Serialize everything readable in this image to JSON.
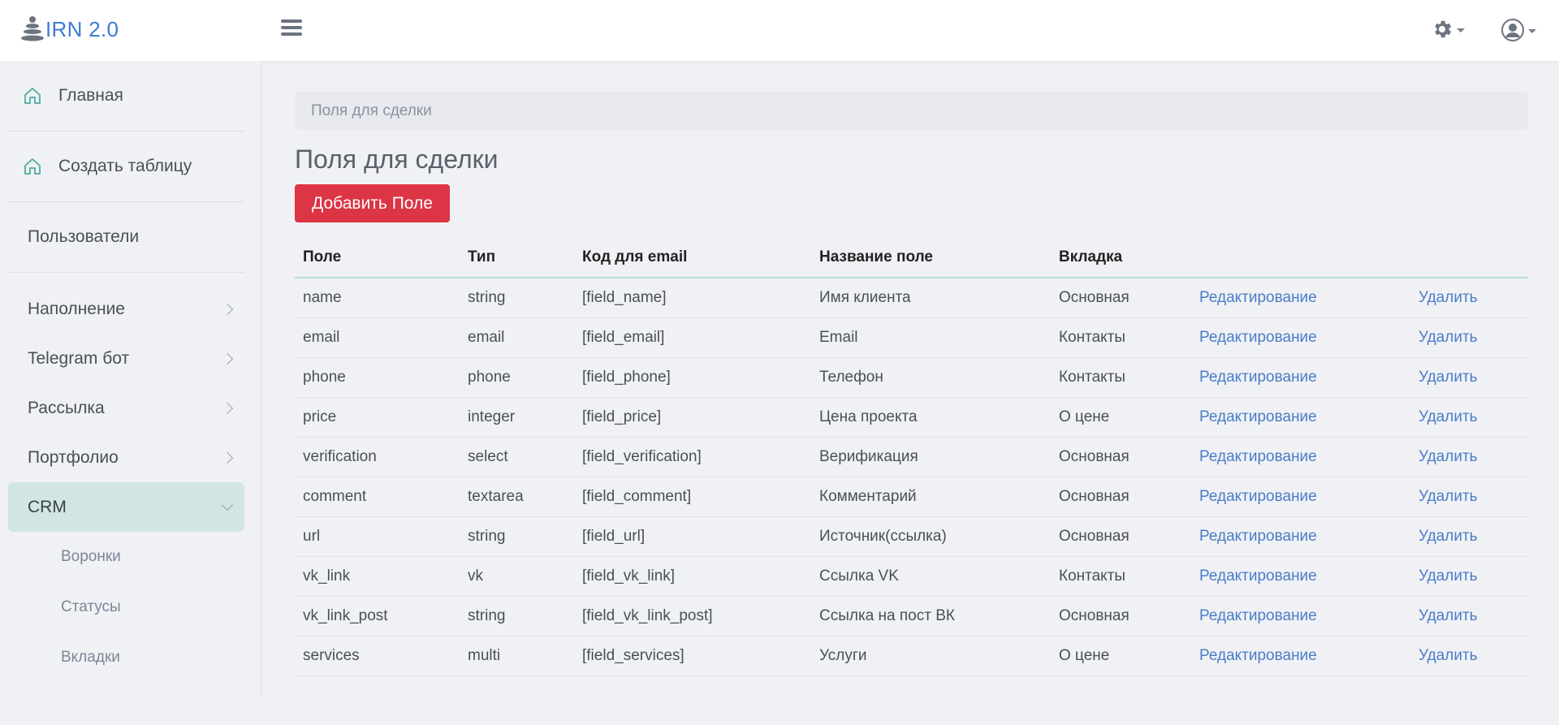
{
  "app": {
    "logo_text": "IRN 2.0"
  },
  "sidebar": {
    "top_items": [
      {
        "label": "Главная"
      },
      {
        "label": "Создать таблицу"
      }
    ],
    "users_label": "Пользователи",
    "groups": [
      {
        "label": "Наполнение"
      },
      {
        "label": "Telegram бот"
      },
      {
        "label": "Рассылка"
      },
      {
        "label": "Портфолио"
      },
      {
        "label": "CRM"
      }
    ],
    "crm_sub": [
      "Воронки",
      "Статусы",
      "Вкладки"
    ]
  },
  "breadcrumb": "Поля для сделки",
  "page_title": "Поля для сделки",
  "add_button": "Добавить Поле",
  "table": {
    "headers": [
      "Поле",
      "Тип",
      "Код для email",
      "Название поле",
      "Вкладка",
      "",
      ""
    ],
    "edit_label": "Редактирование",
    "delete_label": "Удалить",
    "rows": [
      [
        "name",
        "string",
        "[field_name]",
        "Имя клиента",
        "Основная"
      ],
      [
        "email",
        "email",
        "[field_email]",
        "Email",
        "Контакты"
      ],
      [
        "phone",
        "phone",
        "[field_phone]",
        "Телефон",
        "Контакты"
      ],
      [
        "price",
        "integer",
        "[field_price]",
        "Цена проекта",
        "О цене"
      ],
      [
        "verification",
        "select",
        "[field_verification]",
        "Верификация",
        "Основная"
      ],
      [
        "comment",
        "textarea",
        "[field_comment]",
        "Комментарий",
        "Основная"
      ],
      [
        "url",
        "string",
        "[field_url]",
        "Источник(ссылка)",
        "Основная"
      ],
      [
        "vk_link",
        "vk",
        "[field_vk_link]",
        "Ссылка VK",
        "Контакты"
      ],
      [
        "vk_link_post",
        "string",
        "[field_vk_link_post]",
        "Ссылка на пост ВК",
        "Основная"
      ],
      [
        "services",
        "multi",
        "[field_services]",
        "Услуги",
        "О цене"
      ]
    ]
  },
  "colors": {
    "accent": "#dc3545",
    "link": "#4a7dc6",
    "active_bg": "#d1e5e4",
    "logo": "#3d7cd0"
  }
}
